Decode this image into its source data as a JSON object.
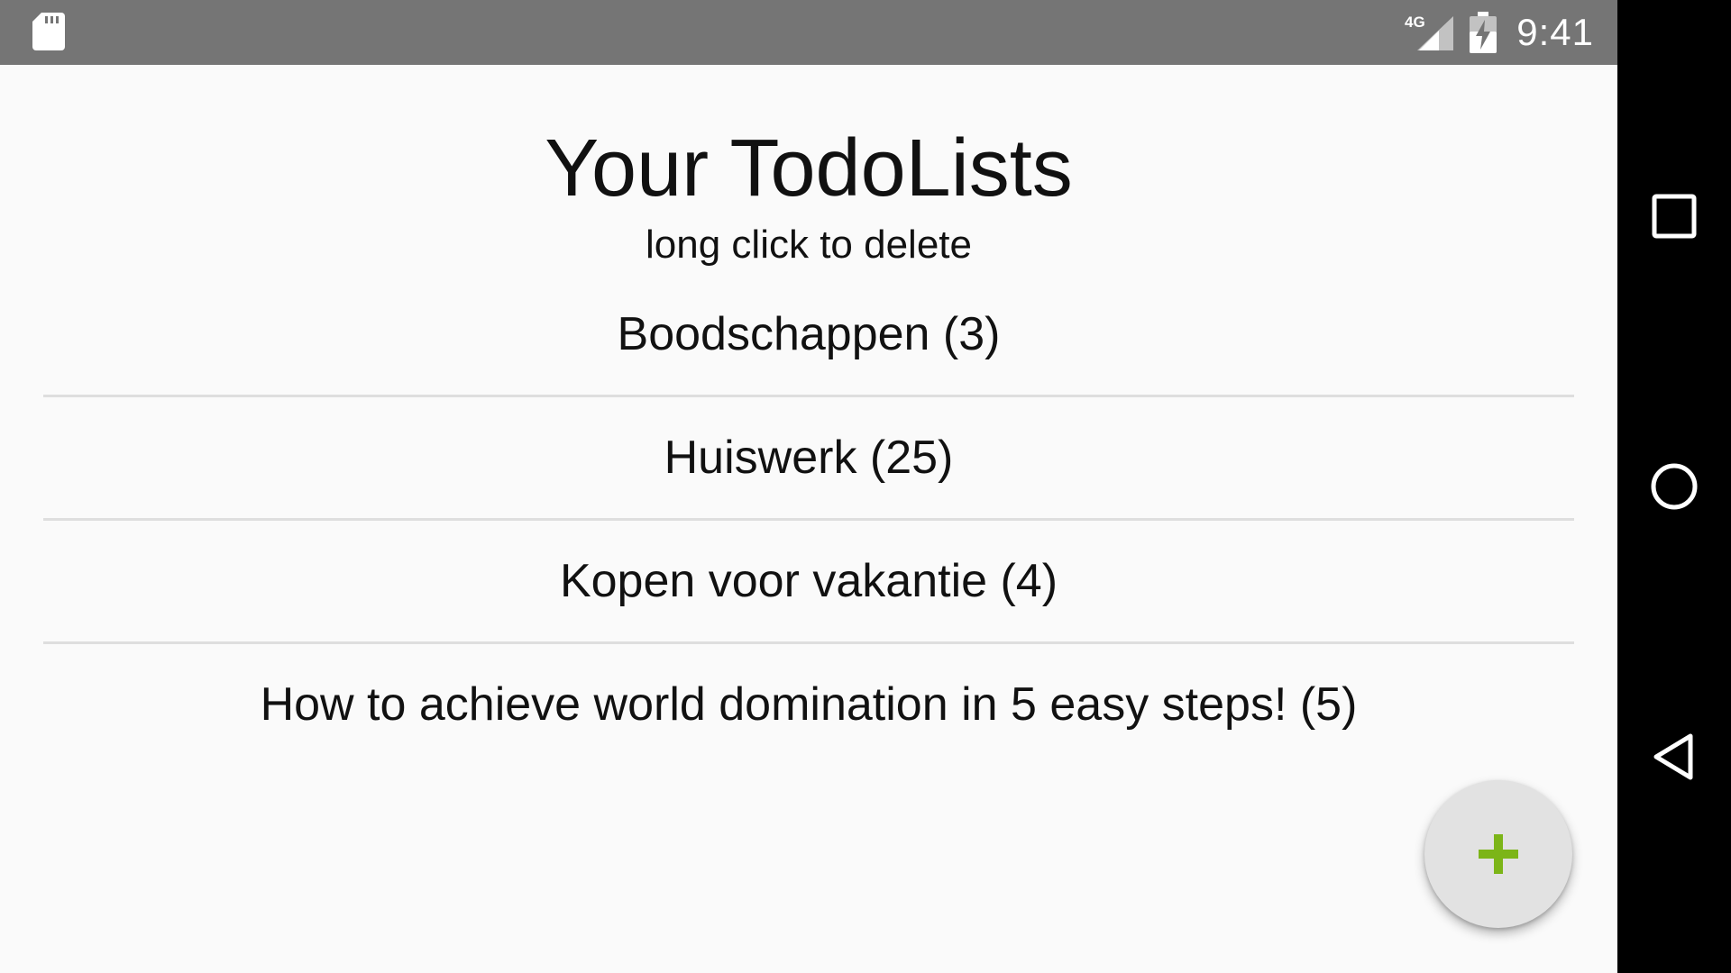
{
  "status_bar": {
    "time": "9:41",
    "network": "4G",
    "icons": [
      "sd-card-icon",
      "signal-4g-icon",
      "battery-charging-icon"
    ]
  },
  "main": {
    "title": "Your TodoLists",
    "subtitle": "long click to delete",
    "lists": [
      {
        "label": "Boodschappen (3)"
      },
      {
        "label": "Huiswerk (25)"
      },
      {
        "label": "Kopen voor vakantie (4)"
      },
      {
        "label": "How to achieve world domination in 5 easy steps! (5)"
      }
    ]
  },
  "fab": {
    "icon": "plus-icon",
    "color": "#7cb518"
  },
  "nav_bar": {
    "buttons": [
      "recents-icon",
      "home-icon",
      "back-icon"
    ]
  },
  "colors": {
    "status_bar": "#757575",
    "background": "#fafafa",
    "divider": "#dedede",
    "nav_bar": "#000000",
    "fab_background": "#e2e2e2",
    "accent": "#7cb518"
  }
}
